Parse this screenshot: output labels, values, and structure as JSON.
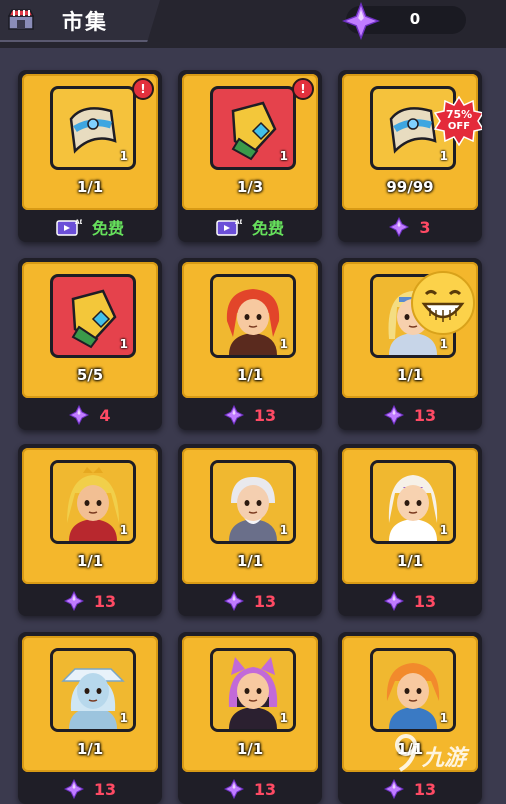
{
  "header": {
    "title": "市集",
    "gem_count": "0"
  },
  "cards": [
    {
      "limit": "1/1",
      "qty": "1",
      "price_type": "ad",
      "price": "免费",
      "item": "scroll",
      "box": "gold",
      "alert": "!"
    },
    {
      "limit": "1/3",
      "qty": "1",
      "price_type": "ad",
      "price": "免费",
      "item": "gauntlet",
      "box": "red",
      "alert": "!"
    },
    {
      "limit": "99/99",
      "qty": "1",
      "price_type": "gem",
      "price": "3",
      "item": "scroll",
      "box": "gold",
      "discount": "75%",
      "discount_label": "OFF"
    },
    {
      "limit": "5/5",
      "qty": "1",
      "price_type": "gem",
      "price": "4",
      "item": "gauntlet",
      "box": "red"
    },
    {
      "limit": "1/1",
      "qty": "1",
      "price_type": "gem",
      "price": "13",
      "item": "hero-red-hair",
      "box": "gold"
    },
    {
      "limit": "1/1",
      "qty": "1",
      "price_type": "gem",
      "price": "13",
      "item": "hero-blonde",
      "box": "gold"
    },
    {
      "limit": "1/1",
      "qty": "1",
      "price_type": "gem",
      "price": "13",
      "item": "hero-golden-king",
      "box": "gold"
    },
    {
      "limit": "1/1",
      "qty": "1",
      "price_type": "gem",
      "price": "13",
      "item": "hero-old-wizard",
      "box": "gold"
    },
    {
      "limit": "1/1",
      "qty": "1",
      "price_type": "gem",
      "price": "13",
      "item": "hero-priestess",
      "box": "gold"
    },
    {
      "limit": "1/1",
      "qty": "1",
      "price_type": "gem",
      "price": "13",
      "item": "hero-ice-mage",
      "box": "gold"
    },
    {
      "limit": "1/1",
      "qty": "1",
      "price_type": "gem",
      "price": "13",
      "item": "hero-cat-ninja",
      "box": "gold"
    },
    {
      "limit": "1/1",
      "qty": "1",
      "price_type": "gem",
      "price": "13",
      "item": "hero-orange-archer",
      "box": "gold"
    }
  ],
  "watermark": {
    "text": "九游"
  },
  "colors": {
    "background": "#3b3a4e",
    "card_gold": "#f4b72c",
    "gem_purple": "#b06bff",
    "price_red": "#ff4a64",
    "free_green": "#66e05c"
  }
}
